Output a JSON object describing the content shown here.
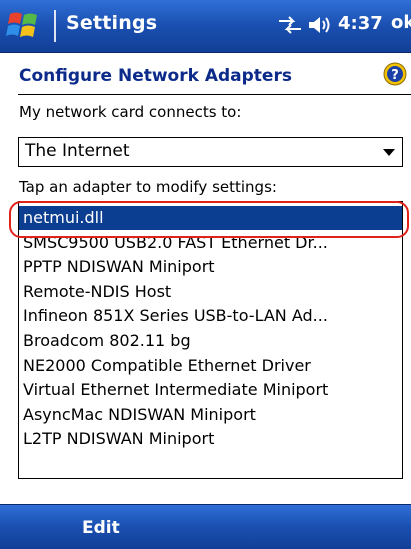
{
  "titlebar": {
    "title": "Settings",
    "time": "4:37",
    "ok_label": "ok",
    "icons": [
      "start-flag-icon",
      "connectivity-icon",
      "volume-icon"
    ]
  },
  "header": {
    "page_title": "Configure Network Adapters",
    "help_icon": "help-icon"
  },
  "connects_label": "My network card connects to:",
  "connects_value": "The Internet",
  "tap_label": "Tap an adapter to modify settings:",
  "adapters": [
    "netmui.dll",
    "SMSC9500 USB2.0 FAST Ethernet Dr...",
    "PPTP NDISWAN Miniport",
    "Remote-NDIS Host",
    "Infineon 851X Series USB-to-LAN Ad...",
    "Broadcom 802.11 bg",
    "NE2000 Compatible Ethernet Driver",
    "Virtual Ethernet Intermediate Miniport",
    "AsyncMac NDISWAN Miniport",
    "L2TP NDISWAN Miniport"
  ],
  "selected_index": 0,
  "softkeys": {
    "left": "Edit"
  },
  "colors": {
    "titlebar": "#1a4fb0",
    "selection": "#0b3d91",
    "header_text": "#0b2a8a",
    "annotation_oval": "#e0221b"
  }
}
